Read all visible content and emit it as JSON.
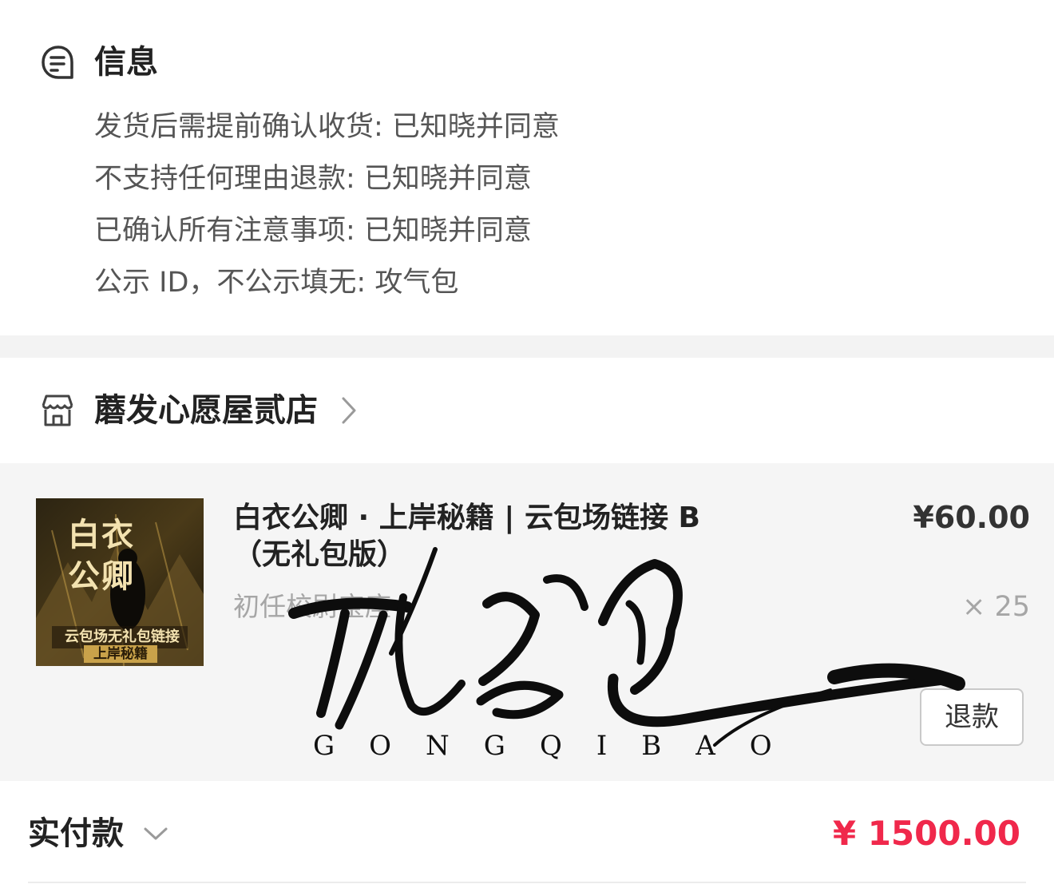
{
  "info": {
    "title": "信息",
    "lines": [
      "发货后需提前确认收货: 已知晓并同意",
      "不支持任何理由退款: 已知晓并同意",
      "已确认所有注意事项: 已知晓并同意",
      "公示 ID，不公示填无: 攻气包"
    ]
  },
  "store": {
    "name": "蘑发心愿屋贰店"
  },
  "product": {
    "title_line1": "白衣公卿 · 上岸秘籍 | 云包场链接 B",
    "title_line2": "（无礼包版）",
    "variant": "初任校尉宝座",
    "price": "¥60.00",
    "quantity": "× 25",
    "refund_label": "退款",
    "thumbnail": {
      "title_chars": "白衣公卿",
      "subtitle": "云包场无礼包链接",
      "banner": "上岸秘籍"
    }
  },
  "watermark": {
    "latin": "GONGQIBAO"
  },
  "payment": {
    "label": "实付款",
    "amount": "¥ 1500.00"
  },
  "colors": {
    "accent_price": "#f0284b",
    "text_primary": "#222222",
    "text_secondary": "#555555",
    "text_muted": "#a6a6a6",
    "card_bg": "#f5f5f5"
  },
  "icons": [
    "info-chat-icon",
    "store-icon",
    "chevron-right-icon",
    "chevron-down-icon"
  ]
}
